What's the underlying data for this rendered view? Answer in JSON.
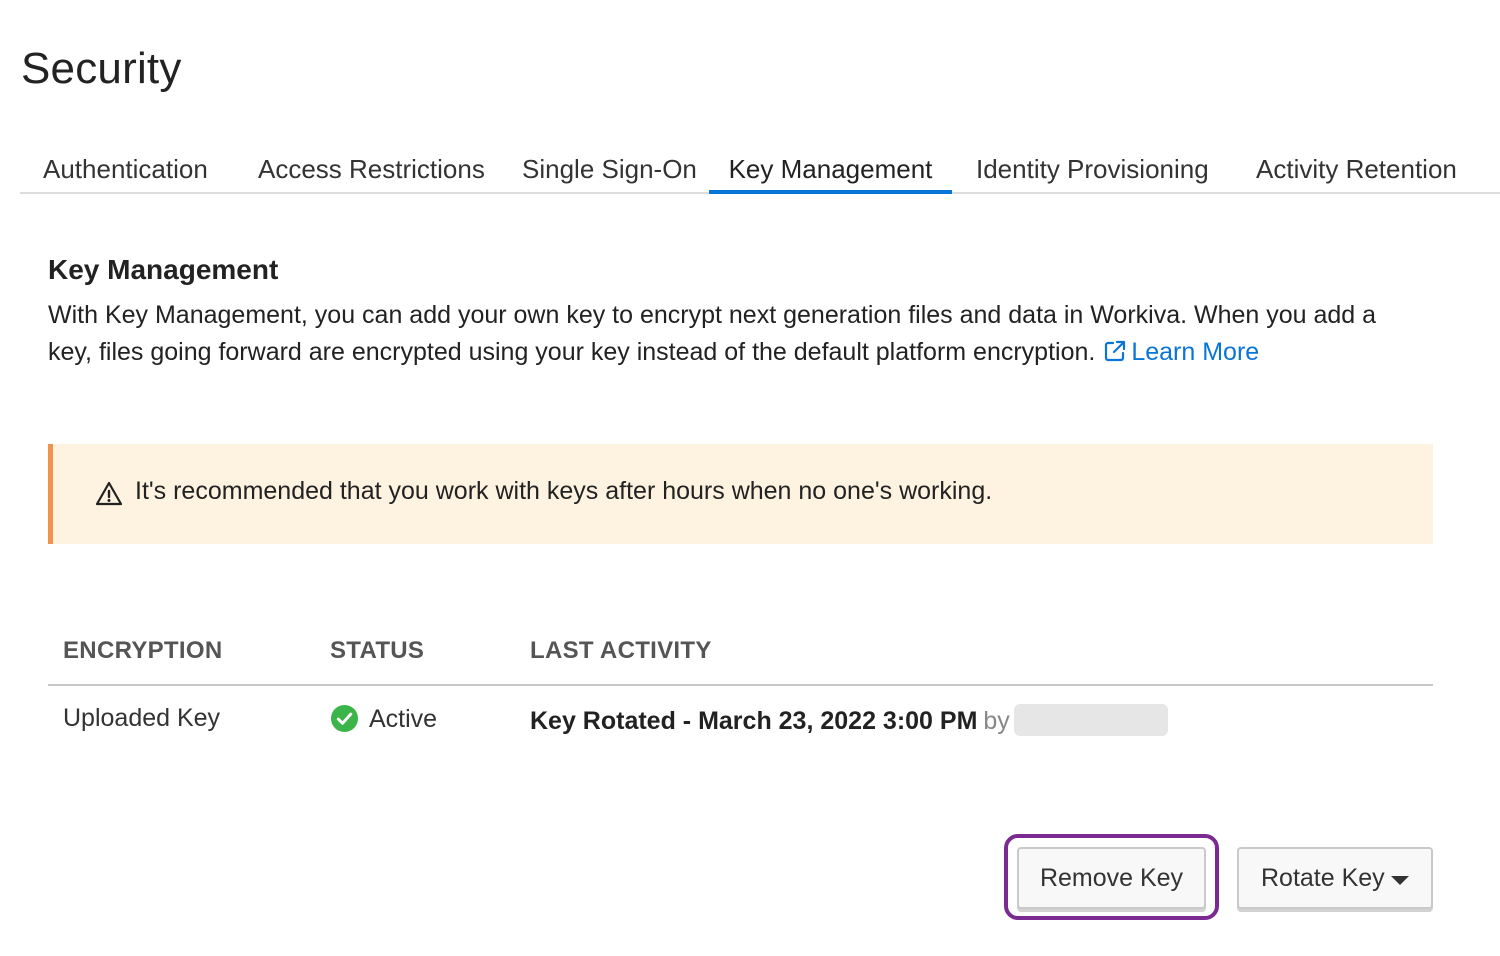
{
  "page": {
    "title": "Security"
  },
  "tabs": [
    {
      "label": "Authentication"
    },
    {
      "label": "Access Restrictions"
    },
    {
      "label": "Single Sign-On"
    },
    {
      "label": "Key Management",
      "active": true
    },
    {
      "label": "Identity Provisioning"
    },
    {
      "label": "Activity Retention"
    }
  ],
  "section": {
    "title": "Key Management",
    "description": "With Key Management, you can add your own key to encrypt next generation files and data in Workiva. When you add a key, files going forward are encrypted using your key instead of the default platform encryption.",
    "learn_more_label": "Learn More",
    "learn_more_icon": "external-link-icon"
  },
  "alert": {
    "icon": "warning-icon",
    "text": "It's recommended that you work with keys after hours when no one's working.",
    "background": "#fdf3e0",
    "accent": "#f0934f"
  },
  "table": {
    "headers": {
      "encryption": "ENCRYPTION",
      "status": "STATUS",
      "last_activity": "LAST ACTIVITY"
    },
    "rows": [
      {
        "encryption": "Uploaded Key",
        "status": "Active",
        "status_icon": "check-circle-icon",
        "status_color": "#3bb54a",
        "activity": "Key Rotated - March 23, 2022 3:00 PM",
        "by_label": "by"
      }
    ]
  },
  "actions": {
    "remove_label": "Remove Key",
    "rotate_label": "Rotate Key",
    "rotate_icon": "caret-down-icon",
    "highlight_color": "#7b2a91"
  },
  "colors": {
    "link": "#0a75d8",
    "active_tab": "#0a75d8"
  }
}
